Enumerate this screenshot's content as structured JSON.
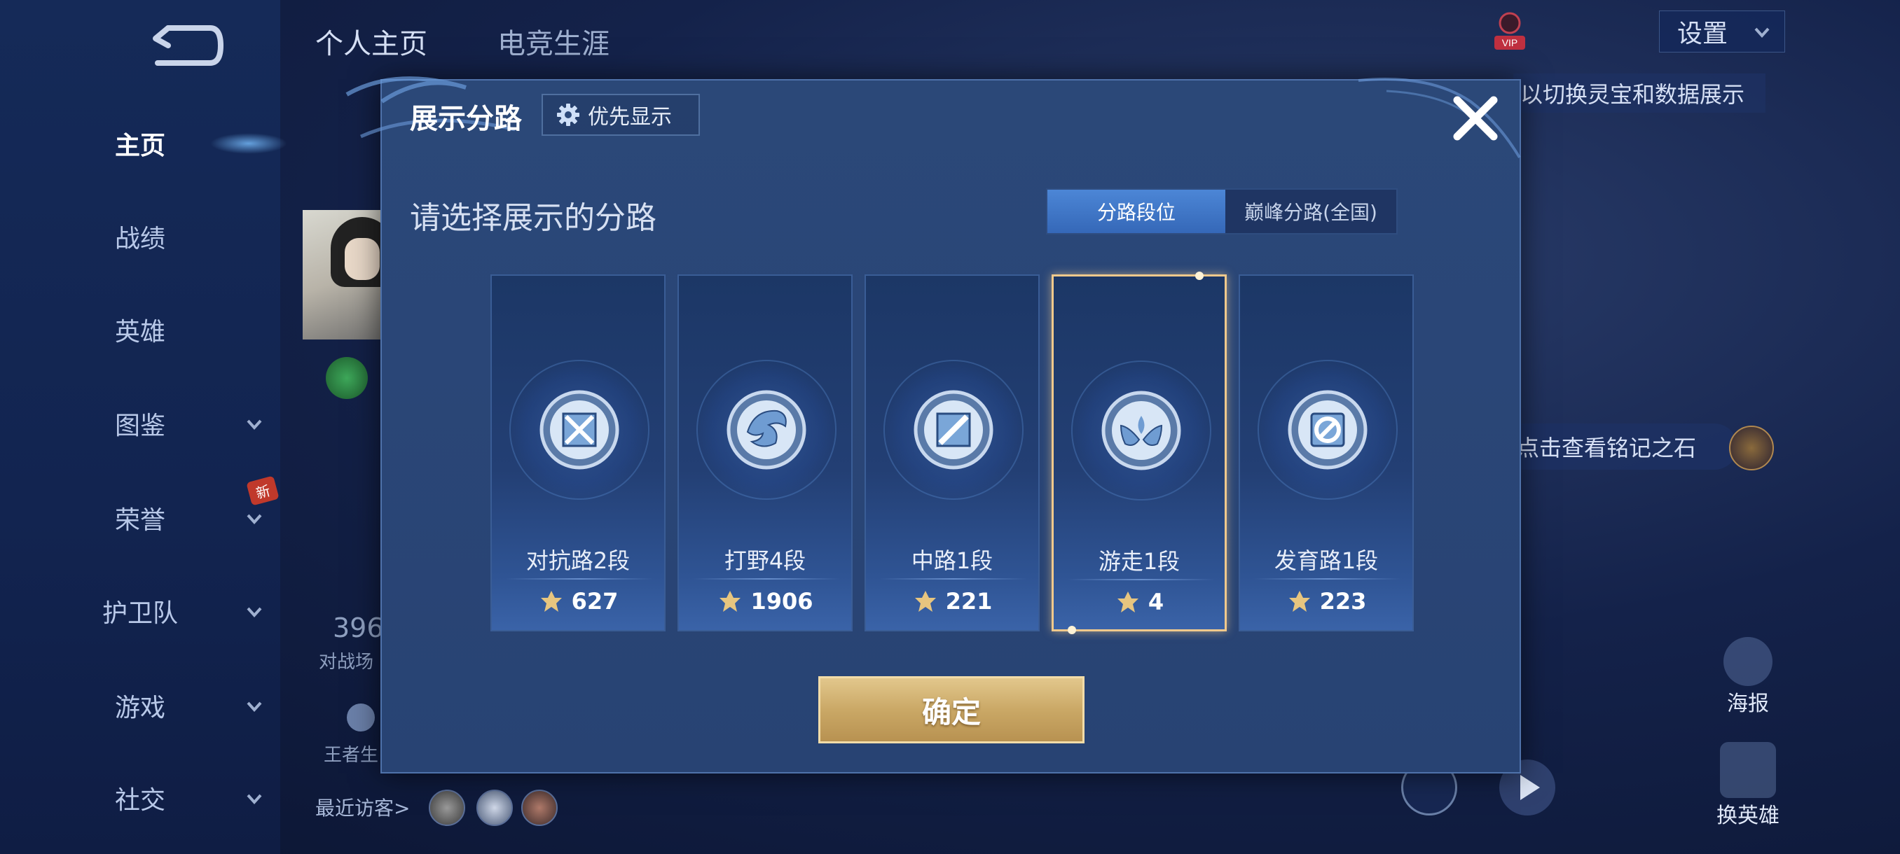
{
  "background": {
    "top_tabs": [
      "个人主页",
      "电竞生涯"
    ],
    "nav_items": [
      {
        "label": "主页",
        "active": true,
        "has_chevron": false
      },
      {
        "label": "战绩",
        "active": false,
        "has_chevron": false
      },
      {
        "label": "英雄",
        "active": false,
        "has_chevron": false
      },
      {
        "label": "图鉴",
        "active": false,
        "has_chevron": true
      },
      {
        "label": "荣誉",
        "active": false,
        "has_chevron": true
      },
      {
        "label": "护卫队",
        "active": false,
        "has_chevron": true
      },
      {
        "label": "游戏",
        "active": false,
        "has_chevron": true
      },
      {
        "label": "社交",
        "active": false,
        "has_chevron": true
      }
    ],
    "new_badge": "新",
    "settings_label": "设置",
    "hint_banner": "以切换灵宝和数据展示",
    "rune_hint": "点击查看铭记之石",
    "poster_label": "海报",
    "swap_hero_label": "换英雄",
    "recent_visitors_label": "最近访客>",
    "stat_number": "396",
    "stat_label": "对战场",
    "king_label": "王者生"
  },
  "modal": {
    "title": "展示分路",
    "priority_button": "优先显示",
    "subtitle": "请选择展示的分路",
    "toggle": {
      "options": [
        "分路段位",
        "巅峰分路(全国)"
      ],
      "active_index": 0
    },
    "lanes": [
      {
        "name": "对抗路2段",
        "score": "627",
        "emblem": "clash-lane-emblem",
        "selected": false
      },
      {
        "name": "打野4段",
        "score": "1906",
        "emblem": "jungle-emblem",
        "selected": false
      },
      {
        "name": "中路1段",
        "score": "221",
        "emblem": "mid-lane-emblem",
        "selected": false
      },
      {
        "name": "游走1段",
        "score": "4",
        "emblem": "roam-emblem",
        "selected": true
      },
      {
        "name": "发育路1段",
        "score": "223",
        "emblem": "farm-lane-emblem",
        "selected": false
      }
    ],
    "confirm_button": "确定"
  },
  "colors": {
    "accent_blue": "#3d77c8",
    "selection_gold": "#f0c98c",
    "confirm_gold": "#caa866"
  }
}
